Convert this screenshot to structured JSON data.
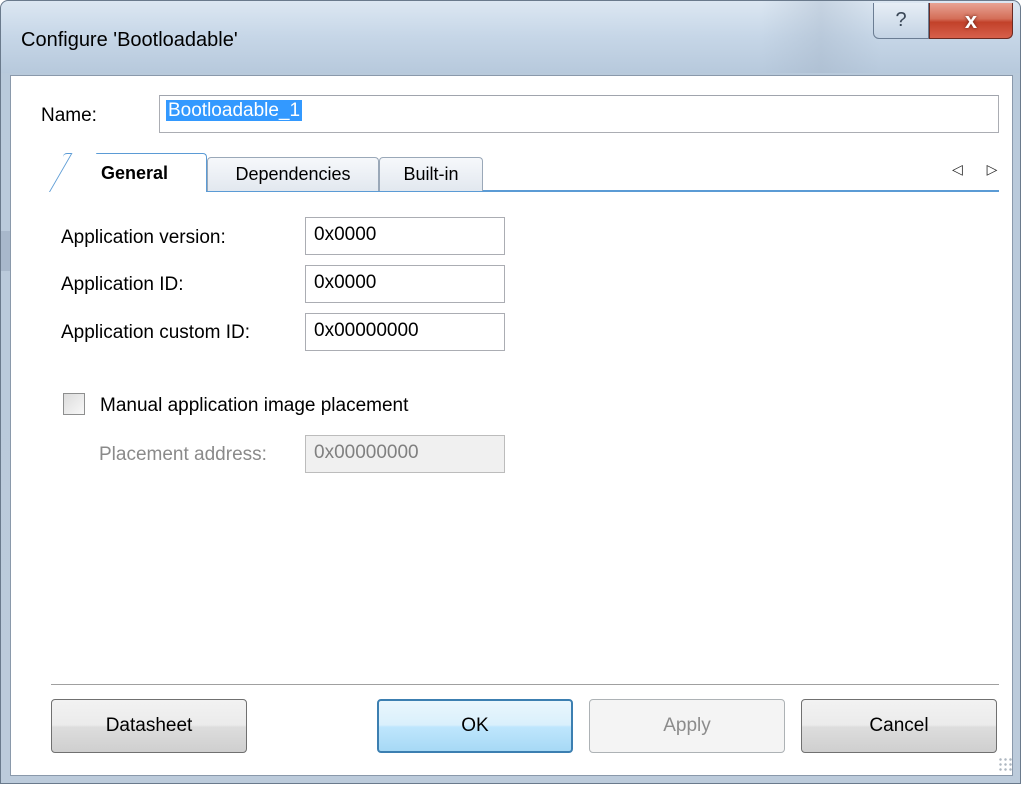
{
  "window": {
    "title": "Configure 'Bootloadable'",
    "help_label": "?",
    "close_label": "x"
  },
  "name": {
    "label": "Name:",
    "value": "Bootloadable_1"
  },
  "tabs": [
    {
      "label": "General",
      "active": true
    },
    {
      "label": "Dependencies",
      "active": false
    },
    {
      "label": "Built-in",
      "active": false
    }
  ],
  "tab_scroll": {
    "left_icon": "triangle-left-icon",
    "right_icon": "triangle-right-icon",
    "glyphs": "◁ ▷"
  },
  "fields": [
    {
      "label": "Application version:",
      "value": "0x0000"
    },
    {
      "label": "Application ID:",
      "value": "0x0000"
    },
    {
      "label": "Application custom ID:",
      "value": "0x00000000"
    }
  ],
  "manual_placement": {
    "label": "Manual application image placement",
    "checked": false
  },
  "placement_address": {
    "label": "Placement address:",
    "value": "0x00000000",
    "disabled": true
  },
  "buttons": {
    "datasheet": "Datasheet",
    "ok": "OK",
    "apply": "Apply",
    "cancel": "Cancel"
  },
  "colors": {
    "accent": "#5b9bd5",
    "close_red": "#c2412a",
    "selection": "#3399ff"
  }
}
